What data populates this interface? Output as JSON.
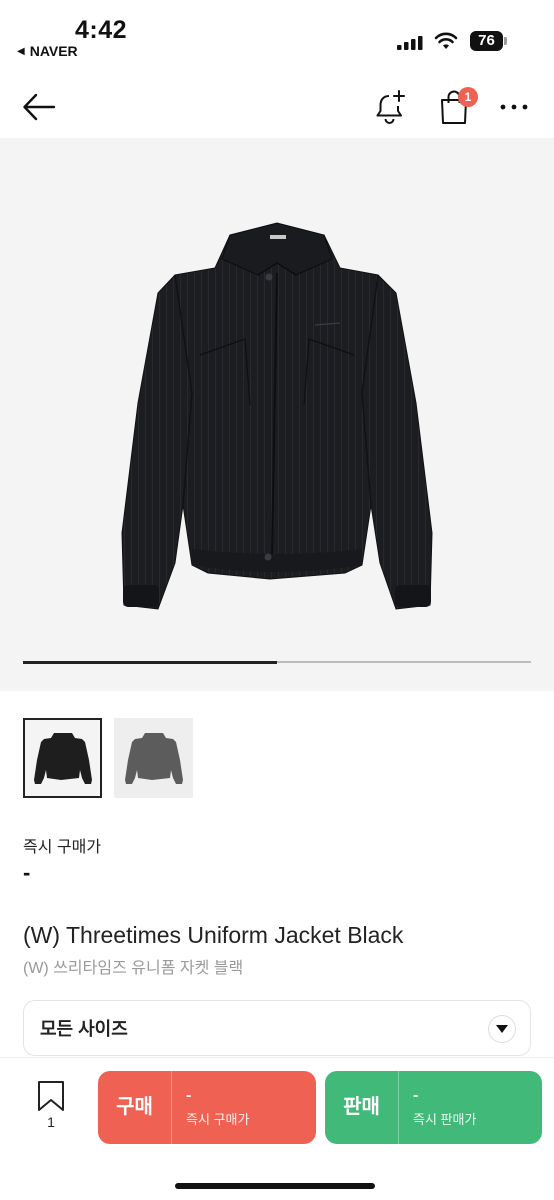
{
  "status_bar": {
    "time": "4:42",
    "back_app": "NAVER",
    "battery": "76"
  },
  "header": {
    "icons": [
      "back-arrow-icon",
      "bell-plus-icon",
      "shopping-bag-icon",
      "more-icon"
    ],
    "bag_badge": "1"
  },
  "hero": {
    "image_pager_progress": 0.5
  },
  "thumbnails": [
    {
      "color": "#1e1e1e",
      "selected": true
    },
    {
      "color": "#5c5c5c",
      "selected": false
    }
  ],
  "product": {
    "price_label": "즉시 구매가",
    "price_value": "-",
    "title_en": "(W) Threetimes Uniform Jacket Black",
    "title_ko": "(W) 쓰리타임즈 유니폼 자켓 블랙"
  },
  "size_selector": {
    "label": "모든 사이즈"
  },
  "bottom_bar": {
    "save_count": "1",
    "buy": {
      "label": "구매",
      "price": "-",
      "caption": "즉시 구매가",
      "color": "#ef6253"
    },
    "sell": {
      "label": "판매",
      "price": "-",
      "caption": "즉시 판매가",
      "color": "#41b979"
    }
  }
}
